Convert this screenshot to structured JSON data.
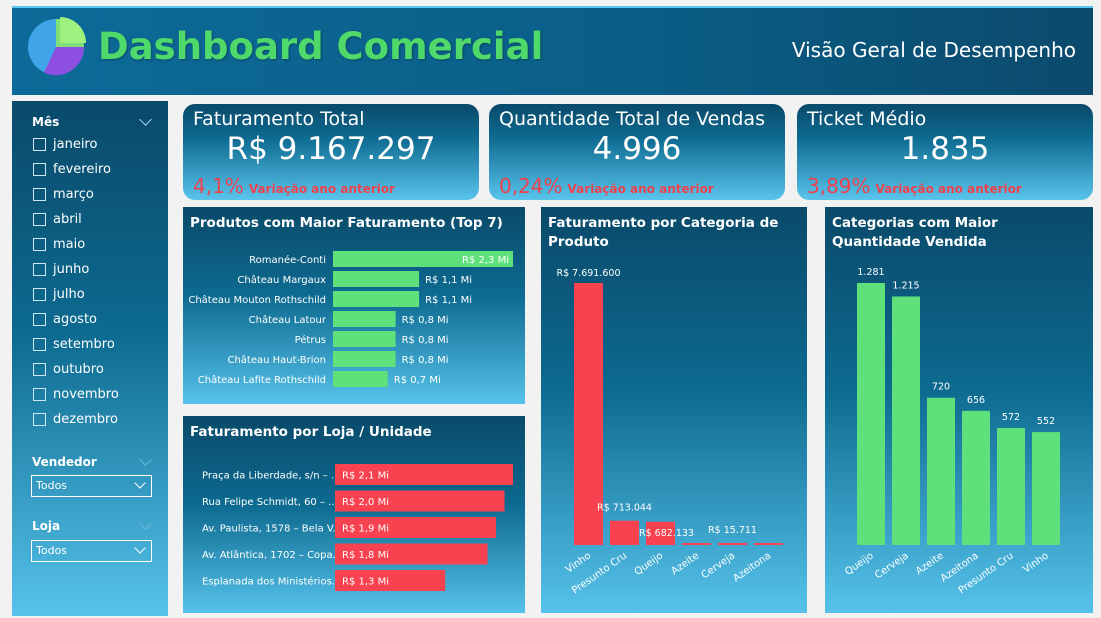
{
  "header": {
    "title": "Dashboard Comercial",
    "subtitle": "Visão Geral de Desempenho",
    "colors": {
      "title": "#4ed96a",
      "accent_red": "#f8424f",
      "bar_green": "#5ee07a"
    }
  },
  "slicers": {
    "month": {
      "label": "Mês",
      "items": [
        "janeiro",
        "fevereiro",
        "março",
        "abril",
        "maio",
        "junho",
        "julho",
        "agosto",
        "setembro",
        "outubro",
        "novembro",
        "dezembro"
      ]
    },
    "seller": {
      "label": "Vendedor",
      "value": "Todos"
    },
    "store": {
      "label": "Loja",
      "value": "Todos"
    }
  },
  "kpis": [
    {
      "title": "Faturamento Total",
      "value": "R$ 9.167.297",
      "delta": "4,1%",
      "delta_label": "Variação ano anterior"
    },
    {
      "title": "Quantidade Total de Vendas",
      "value": "4.996",
      "delta": "0,24%",
      "delta_label": "Variação ano anterior"
    },
    {
      "title": "Ticket Médio",
      "value": "1.835",
      "delta": "3,89%",
      "delta_label": "Variação ano anterior"
    }
  ],
  "chart_data": [
    {
      "type": "bar",
      "orientation": "horizontal",
      "title": "Produtos com Maior Faturamento (Top 7)",
      "categories": [
        "Romanée-Conti",
        "Château Margaux",
        "Château Mouton Rothschild",
        "Château Latour",
        "Pétrus",
        "Château Haut-Brion",
        "Château Lafite Rothschild"
      ],
      "values": [
        2.3,
        1.1,
        1.1,
        0.8,
        0.8,
        0.8,
        0.7
      ],
      "data_labels": [
        "R$ 2,3 Mi",
        "R$ 1,1 Mi",
        "R$ 1,1 Mi",
        "R$ 0,8 Mi",
        "R$ 0,8 Mi",
        "R$ 0,8 Mi",
        "R$ 0,7 Mi"
      ],
      "unit": "R$ Mi",
      "color": "#5ee07a"
    },
    {
      "type": "bar",
      "orientation": "horizontal",
      "title": "Faturamento por Loja / Unidade",
      "categories": [
        "Praça da Liberdade, s/n – ...",
        "Rua Felipe Schmidt, 60 – ...",
        "Av. Paulista, 1578 – Bela V...",
        "Av. Atlântica, 1702 – Copa...",
        "Esplanada dos Ministérios..."
      ],
      "values": [
        2.1,
        2.0,
        1.9,
        1.8,
        1.3
      ],
      "data_labels": [
        "R$ 2,1 Mi",
        "R$ 2,0 Mi",
        "R$ 1,9 Mi",
        "R$ 1,8 Mi",
        "R$ 1,3 Mi"
      ],
      "unit": "R$ Mi",
      "color": "#f8424f"
    },
    {
      "type": "bar",
      "title": "Faturamento por Categoria de Produto",
      "categories": [
        "Vinho",
        "Presunto Cru",
        "Queijo",
        "Azeite",
        "Cerveja",
        "Azeitona"
      ],
      "values": [
        7691600,
        713044,
        682133,
        30000,
        15711,
        15000
      ],
      "data_labels": [
        "R$ 7.691.600",
        "R$ 713.044",
        "R$ 682.133",
        "",
        "R$ 15.711",
        ""
      ],
      "color": "#f8424f"
    },
    {
      "type": "bar",
      "title": "Categorias com Maior Quantidade Vendida",
      "categories": [
        "Queijo",
        "Cerveja",
        "Azeite",
        "Azeitona",
        "Presunto Cru",
        "Vinho"
      ],
      "values": [
        1281,
        1215,
        720,
        656,
        572,
        552
      ],
      "data_labels": [
        "1.281",
        "1.215",
        "720",
        "656",
        "572",
        "552"
      ],
      "color": "#5ee07a"
    }
  ]
}
